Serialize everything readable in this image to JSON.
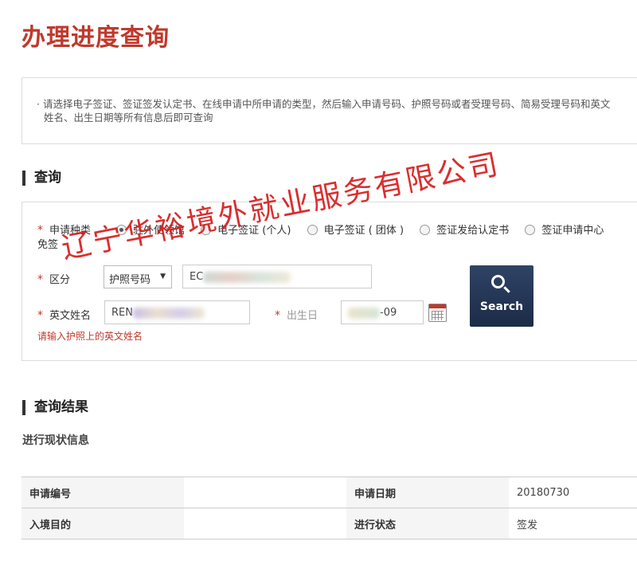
{
  "page": {
    "title": "办理进度查询"
  },
  "notice": {
    "line1": "· 请选择电子签证、签证签发认定书、在线申请中所申请的类型，然后输入申请号码、护照号码或者受理号码、简易受理号码和英文",
    "line2": "姓名、出生日期等所有信息后即可查询"
  },
  "query": {
    "heading": "查询",
    "required_mark": "*",
    "type_label": "申请种类",
    "type_options": [
      "驻外使领馆",
      "电子签证 (个人)",
      "电子签证 ( 团体 )",
      "签证发给认定书",
      "签证申请中心"
    ],
    "type_selected": "驻外使领馆",
    "type_wrap": "免签",
    "division_label": "区分",
    "division_select": "护照号码",
    "passport_value": "EC",
    "name_label": "英文姓名",
    "name_value": "REN",
    "birth_label": "出生日",
    "birth_value": "-09",
    "search_button": "Search",
    "hint": "请输入护照上的英文姓名"
  },
  "result": {
    "heading": "查询结果",
    "subheading": "进行现状信息",
    "rows": [
      {
        "label1": "申请编号",
        "value1": "",
        "label2": "申请日期",
        "value2": "20180730"
      },
      {
        "label1": "入境目的",
        "value1": "",
        "label2": "进行状态",
        "value2": "签发"
      }
    ]
  },
  "watermark": {
    "text": "辽宁华裕境外就业服务有限公司"
  },
  "colors": {
    "accent": "#c0392b",
    "button": "#1c2b47"
  }
}
